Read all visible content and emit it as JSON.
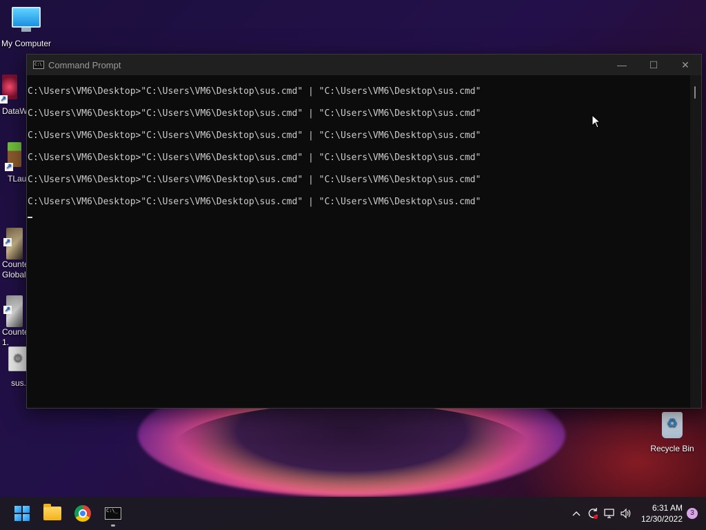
{
  "desktop": {
    "icons": [
      {
        "label": "My Computer"
      },
      {
        "label": "DataW"
      },
      {
        "label": "TLaun"
      },
      {
        "label": "Counte\nGlobal"
      },
      {
        "label": "Counte\n1."
      },
      {
        "label": "sus.c"
      },
      {
        "label": "Recycle Bin"
      }
    ]
  },
  "window": {
    "title": "Command Prompt",
    "controls": {
      "minimize": "—",
      "maximize": "☐",
      "close": "✕"
    },
    "lines": [
      "C:\\Users\\VM6\\Desktop>\"C:\\Users\\VM6\\Desktop\\sus.cmd\" | \"C:\\Users\\VM6\\Desktop\\sus.cmd\"",
      "C:\\Users\\VM6\\Desktop>\"C:\\Users\\VM6\\Desktop\\sus.cmd\" | \"C:\\Users\\VM6\\Desktop\\sus.cmd\"",
      "C:\\Users\\VM6\\Desktop>\"C:\\Users\\VM6\\Desktop\\sus.cmd\" | \"C:\\Users\\VM6\\Desktop\\sus.cmd\"",
      "C:\\Users\\VM6\\Desktop>\"C:\\Users\\VM6\\Desktop\\sus.cmd\" | \"C:\\Users\\VM6\\Desktop\\sus.cmd\"",
      "C:\\Users\\VM6\\Desktop>\"C:\\Users\\VM6\\Desktop\\sus.cmd\" | \"C:\\Users\\VM6\\Desktop\\sus.cmd\"",
      "C:\\Users\\VM6\\Desktop>\"C:\\Users\\VM6\\Desktop\\sus.cmd\" | \"C:\\Users\\VM6\\Desktop\\sus.cmd\""
    ]
  },
  "taskbar": {
    "apps": [
      {
        "name": "start",
        "icon": "windows-logo-icon"
      },
      {
        "name": "file-explorer",
        "icon": "folder-icon"
      },
      {
        "name": "chrome",
        "icon": "chrome-icon"
      },
      {
        "name": "command-prompt",
        "icon": "cmd-icon",
        "active": true
      }
    ],
    "tray": {
      "chevron": "^",
      "time": "6:31 AM",
      "date": "12/30/2022",
      "notifications": "3"
    }
  },
  "colors": {
    "console_bg": "#0c0c0c",
    "console_text": "#cccccc",
    "titlebar_bg": "#202020"
  }
}
